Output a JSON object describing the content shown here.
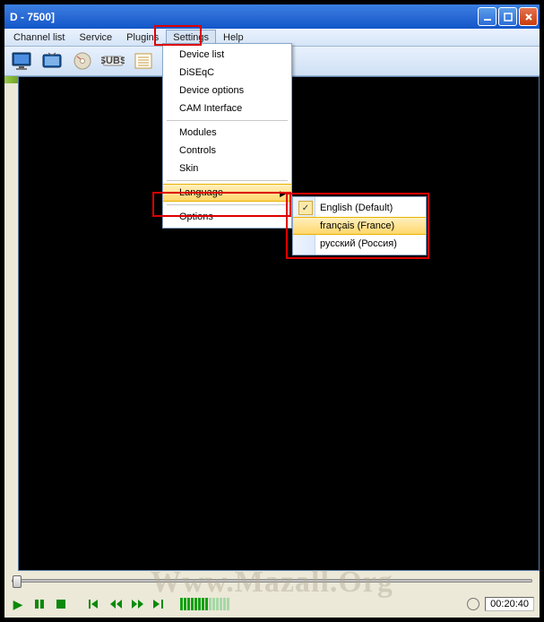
{
  "title": "D - 7500]",
  "menu": {
    "items": [
      "Channel list",
      "Service",
      "Plugins",
      "Settings",
      "Help"
    ],
    "activeIndex": 3
  },
  "settings_dropdown": {
    "items": [
      {
        "label": "Device list"
      },
      {
        "label": "DiSEqC"
      },
      {
        "label": "Device options"
      },
      {
        "label": "CAM Interface"
      },
      {
        "sep": true
      },
      {
        "label": "Modules"
      },
      {
        "label": "Controls"
      },
      {
        "label": "Skin"
      },
      {
        "sep": true
      },
      {
        "label": "Language",
        "submenu": true,
        "hov": true
      },
      {
        "sep": true
      },
      {
        "label": "Options"
      }
    ]
  },
  "language_submenu": {
    "items": [
      {
        "label": "English (Default)",
        "checked": true
      },
      {
        "label": "français (France)",
        "hov": true
      },
      {
        "label": "русский (Россия)"
      }
    ]
  },
  "status": {
    "time": "00:20:40"
  },
  "watermark": "Www.Mazall.Org"
}
